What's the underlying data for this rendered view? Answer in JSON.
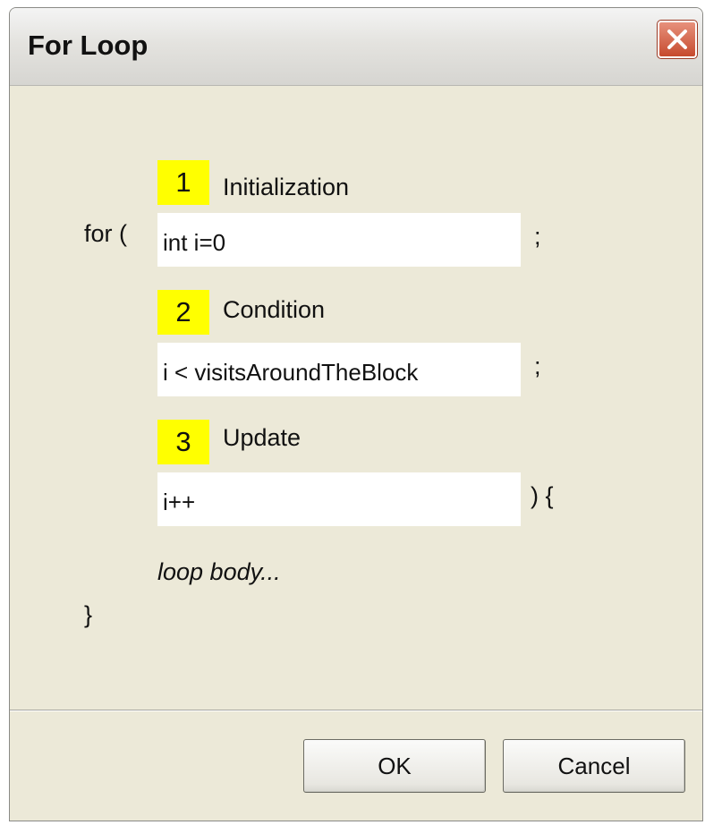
{
  "window": {
    "title": "For Loop",
    "close_icon": "close-x-icon"
  },
  "code": {
    "for_open": "for (",
    "semicolon_1": ";",
    "semicolon_2": ";",
    "paren_brace": ") {",
    "loop_body": "loop body...",
    "close_brace": "}"
  },
  "fields": [
    {
      "number": "1",
      "label": "Initialization",
      "value": "int i=0"
    },
    {
      "number": "2",
      "label": "Condition",
      "value": "i < visitsAroundTheBlock"
    },
    {
      "number": "3",
      "label": "Update",
      "value": "i++"
    }
  ],
  "buttons": {
    "ok": "OK",
    "cancel": "Cancel"
  },
  "colors": {
    "dialog_bg": "#ece9d8",
    "highlight": "#ffff00",
    "close_button": "#c64a2e"
  }
}
